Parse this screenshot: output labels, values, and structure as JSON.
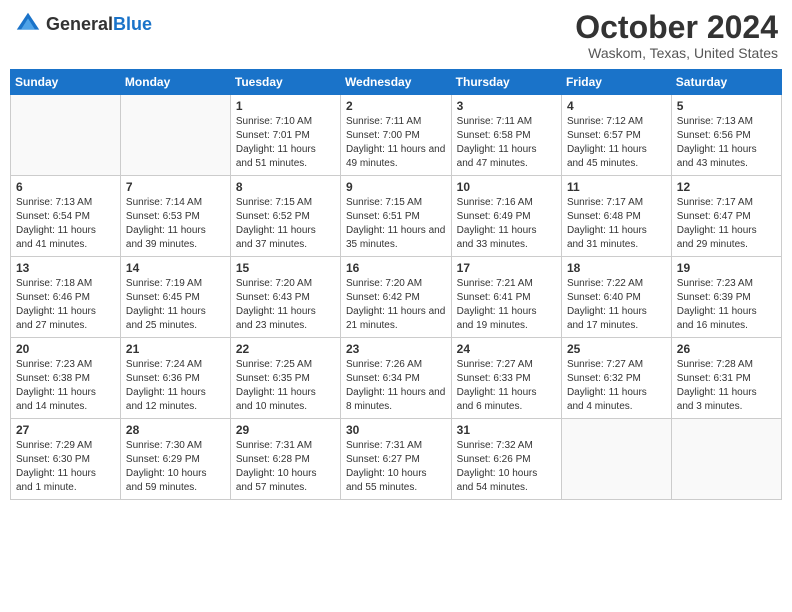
{
  "logo": {
    "general": "General",
    "blue": "Blue"
  },
  "title": {
    "month": "October 2024",
    "location": "Waskom, Texas, United States"
  },
  "weekdays": [
    "Sunday",
    "Monday",
    "Tuesday",
    "Wednesday",
    "Thursday",
    "Friday",
    "Saturday"
  ],
  "weeks": [
    [
      {
        "day": "",
        "info": ""
      },
      {
        "day": "",
        "info": ""
      },
      {
        "day": "1",
        "info": "Sunrise: 7:10 AM\nSunset: 7:01 PM\nDaylight: 11 hours and 51 minutes."
      },
      {
        "day": "2",
        "info": "Sunrise: 7:11 AM\nSunset: 7:00 PM\nDaylight: 11 hours and 49 minutes."
      },
      {
        "day": "3",
        "info": "Sunrise: 7:11 AM\nSunset: 6:58 PM\nDaylight: 11 hours and 47 minutes."
      },
      {
        "day": "4",
        "info": "Sunrise: 7:12 AM\nSunset: 6:57 PM\nDaylight: 11 hours and 45 minutes."
      },
      {
        "day": "5",
        "info": "Sunrise: 7:13 AM\nSunset: 6:56 PM\nDaylight: 11 hours and 43 minutes."
      }
    ],
    [
      {
        "day": "6",
        "info": "Sunrise: 7:13 AM\nSunset: 6:54 PM\nDaylight: 11 hours and 41 minutes."
      },
      {
        "day": "7",
        "info": "Sunrise: 7:14 AM\nSunset: 6:53 PM\nDaylight: 11 hours and 39 minutes."
      },
      {
        "day": "8",
        "info": "Sunrise: 7:15 AM\nSunset: 6:52 PM\nDaylight: 11 hours and 37 minutes."
      },
      {
        "day": "9",
        "info": "Sunrise: 7:15 AM\nSunset: 6:51 PM\nDaylight: 11 hours and 35 minutes."
      },
      {
        "day": "10",
        "info": "Sunrise: 7:16 AM\nSunset: 6:49 PM\nDaylight: 11 hours and 33 minutes."
      },
      {
        "day": "11",
        "info": "Sunrise: 7:17 AM\nSunset: 6:48 PM\nDaylight: 11 hours and 31 minutes."
      },
      {
        "day": "12",
        "info": "Sunrise: 7:17 AM\nSunset: 6:47 PM\nDaylight: 11 hours and 29 minutes."
      }
    ],
    [
      {
        "day": "13",
        "info": "Sunrise: 7:18 AM\nSunset: 6:46 PM\nDaylight: 11 hours and 27 minutes."
      },
      {
        "day": "14",
        "info": "Sunrise: 7:19 AM\nSunset: 6:45 PM\nDaylight: 11 hours and 25 minutes."
      },
      {
        "day": "15",
        "info": "Sunrise: 7:20 AM\nSunset: 6:43 PM\nDaylight: 11 hours and 23 minutes."
      },
      {
        "day": "16",
        "info": "Sunrise: 7:20 AM\nSunset: 6:42 PM\nDaylight: 11 hours and 21 minutes."
      },
      {
        "day": "17",
        "info": "Sunrise: 7:21 AM\nSunset: 6:41 PM\nDaylight: 11 hours and 19 minutes."
      },
      {
        "day": "18",
        "info": "Sunrise: 7:22 AM\nSunset: 6:40 PM\nDaylight: 11 hours and 17 minutes."
      },
      {
        "day": "19",
        "info": "Sunrise: 7:23 AM\nSunset: 6:39 PM\nDaylight: 11 hours and 16 minutes."
      }
    ],
    [
      {
        "day": "20",
        "info": "Sunrise: 7:23 AM\nSunset: 6:38 PM\nDaylight: 11 hours and 14 minutes."
      },
      {
        "day": "21",
        "info": "Sunrise: 7:24 AM\nSunset: 6:36 PM\nDaylight: 11 hours and 12 minutes."
      },
      {
        "day": "22",
        "info": "Sunrise: 7:25 AM\nSunset: 6:35 PM\nDaylight: 11 hours and 10 minutes."
      },
      {
        "day": "23",
        "info": "Sunrise: 7:26 AM\nSunset: 6:34 PM\nDaylight: 11 hours and 8 minutes."
      },
      {
        "day": "24",
        "info": "Sunrise: 7:27 AM\nSunset: 6:33 PM\nDaylight: 11 hours and 6 minutes."
      },
      {
        "day": "25",
        "info": "Sunrise: 7:27 AM\nSunset: 6:32 PM\nDaylight: 11 hours and 4 minutes."
      },
      {
        "day": "26",
        "info": "Sunrise: 7:28 AM\nSunset: 6:31 PM\nDaylight: 11 hours and 3 minutes."
      }
    ],
    [
      {
        "day": "27",
        "info": "Sunrise: 7:29 AM\nSunset: 6:30 PM\nDaylight: 11 hours and 1 minute."
      },
      {
        "day": "28",
        "info": "Sunrise: 7:30 AM\nSunset: 6:29 PM\nDaylight: 10 hours and 59 minutes."
      },
      {
        "day": "29",
        "info": "Sunrise: 7:31 AM\nSunset: 6:28 PM\nDaylight: 10 hours and 57 minutes."
      },
      {
        "day": "30",
        "info": "Sunrise: 7:31 AM\nSunset: 6:27 PM\nDaylight: 10 hours and 55 minutes."
      },
      {
        "day": "31",
        "info": "Sunrise: 7:32 AM\nSunset: 6:26 PM\nDaylight: 10 hours and 54 minutes."
      },
      {
        "day": "",
        "info": ""
      },
      {
        "day": "",
        "info": ""
      }
    ]
  ]
}
